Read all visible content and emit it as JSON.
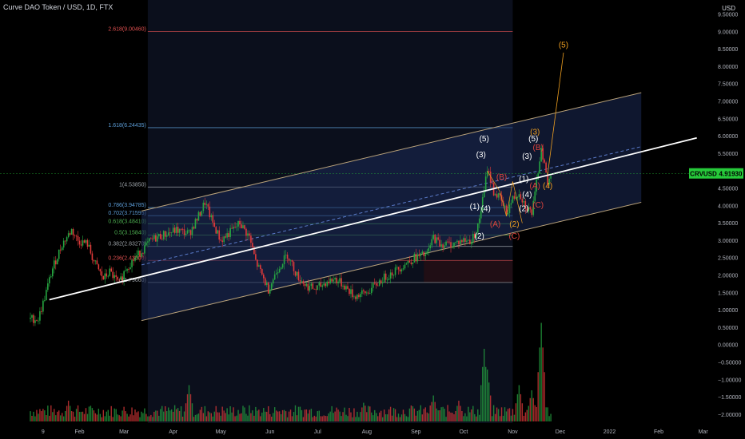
{
  "header": {
    "title": "Curve DAO Token / USD, 1D, FTX",
    "currency": "USD"
  },
  "price_badge": {
    "symbol": "CRVUSD",
    "value": "4.91930",
    "color": "#26c93a"
  },
  "colors": {
    "background": "#000000",
    "channel_fill": "#1b2a56",
    "channel_line": "#b9a27a",
    "trend_line": "#ffffff",
    "candle_up": "#26a641",
    "candle_down": "#e03a3a",
    "wave_white": "#ffffff",
    "wave_red": "#e0443c",
    "wave_orange": "#f0a020"
  },
  "chart_data": {
    "type": "candlestick",
    "title": "Curve DAO Token / USD, 1D, FTX",
    "ylabel": "USD",
    "ylim": [
      -2.2,
      9.6
    ],
    "x_ticks": [
      "9",
      "Feb",
      "Mar",
      "Apr",
      "May",
      "Jun",
      "Jul",
      "Aug",
      "Sep",
      "Oct",
      "Nov",
      "Dec",
      "2022",
      "Feb",
      "Mar"
    ],
    "x_tick_days": [
      8,
      31,
      59,
      90,
      120,
      151,
      181,
      212,
      243,
      273,
      304,
      334,
      365,
      396,
      424
    ],
    "y_ticks": [
      9.5,
      9.0,
      8.5,
      8.0,
      7.5,
      7.0,
      6.5,
      6.0,
      5.5,
      5.0,
      4.5,
      4.0,
      3.5,
      3.0,
      2.5,
      2.0,
      1.5,
      1.0,
      0.5,
      0.0,
      -0.5,
      -1.0,
      -1.5,
      -2.0
    ],
    "y_tick_labels": [
      "9.50000",
      "9.00000",
      "8.50000",
      "8.00000",
      "7.50000",
      "7.00000",
      "6.50000",
      "6.00000",
      "5.50000",
      "5.00000",
      "4.50000",
      "4.00000",
      "3.50000",
      "3.00000",
      "2.50000",
      "2.00000",
      "1.50000",
      "1.00000",
      "0.50000",
      "0.00000",
      "−0.50000",
      "−1.00000",
      "−1.50000",
      "−2.00000"
    ],
    "price_path": [
      [
        0,
        0.75
      ],
      [
        5,
        0.75
      ],
      [
        8,
        1.2
      ],
      [
        14,
        2.2
      ],
      [
        20,
        2.9
      ],
      [
        26,
        3.3
      ],
      [
        30,
        3.0
      ],
      [
        36,
        2.9
      ],
      [
        40,
        2.4
      ],
      [
        46,
        1.9
      ],
      [
        50,
        2.1
      ],
      [
        56,
        1.75
      ],
      [
        60,
        2.2
      ],
      [
        64,
        2.4
      ],
      [
        70,
        2.7
      ],
      [
        76,
        3.0
      ],
      [
        80,
        3.1
      ],
      [
        86,
        3.2
      ],
      [
        92,
        3.3
      ],
      [
        100,
        3.2
      ],
      [
        106,
        3.7
      ],
      [
        110,
        4.1
      ],
      [
        115,
        3.5
      ],
      [
        120,
        3.0
      ],
      [
        125,
        3.2
      ],
      [
        132,
        3.5
      ],
      [
        138,
        3.1
      ],
      [
        142,
        2.4
      ],
      [
        150,
        1.6
      ],
      [
        156,
        2.2
      ],
      [
        162,
        2.6
      ],
      [
        168,
        2.0
      ],
      [
        174,
        1.7
      ],
      [
        180,
        1.6
      ],
      [
        186,
        1.8
      ],
      [
        192,
        1.9
      ],
      [
        198,
        1.7
      ],
      [
        204,
        1.4
      ],
      [
        212,
        1.5
      ],
      [
        222,
        1.9
      ],
      [
        232,
        2.2
      ],
      [
        242,
        2.5
      ],
      [
        250,
        2.6
      ],
      [
        254,
        3.1
      ],
      [
        258,
        2.9
      ],
      [
        266,
        2.9
      ],
      [
        272,
        3.0
      ],
      [
        278,
        3.0
      ],
      [
        282,
        3.4
      ],
      [
        286,
        4.4
      ],
      [
        288,
        5.1
      ],
      [
        292,
        4.4
      ],
      [
        296,
        4.2
      ],
      [
        300,
        3.8
      ],
      [
        304,
        4.2
      ],
      [
        308,
        4.4
      ],
      [
        312,
        4.0
      ],
      [
        316,
        3.8
      ],
      [
        318,
        4.3
      ],
      [
        320,
        5.0
      ],
      [
        322,
        5.7
      ],
      [
        324,
        5.2
      ],
      [
        326,
        4.6
      ],
      [
        328,
        4.9
      ]
    ],
    "volume_spikes": [
      [
        286,
        0.7
      ],
      [
        322,
        0.95
      ],
      [
        288,
        0.5
      ],
      [
        308,
        0.35
      ],
      [
        316,
        0.3
      ],
      [
        254,
        0.25
      ],
      [
        100,
        0.35
      ],
      [
        24,
        0.2
      ],
      [
        210,
        0.18
      ],
      [
        270,
        0.2
      ]
    ],
    "channel": {
      "upper": [
        [
          70,
          3.85
        ],
        [
          385,
          7.25
        ]
      ],
      "lower": [
        [
          70,
          0.7
        ],
        [
          385,
          4.1
        ]
      ],
      "mid": [
        [
          70,
          2.3
        ],
        [
          385,
          5.7
        ]
      ]
    },
    "trend_line": [
      [
        12,
        1.3
      ],
      [
        420,
        5.95
      ]
    ],
    "fib_levels": [
      {
        "label": "2.618(9.00460)",
        "value": 9.0046,
        "color": "#e05050"
      },
      {
        "label": "1.618(6.24435)",
        "value": 6.24435,
        "color": "#5b9bd5"
      },
      {
        "label": "1(4.53850)",
        "value": 4.5385,
        "color": "#9aa0a6"
      },
      {
        "label": "0.786(3.94785)",
        "value": 3.94785,
        "color": "#5b9bd5"
      },
      {
        "label": "0.702(3.71595)",
        "value": 3.71595,
        "color": "#5b9bd5"
      },
      {
        "label": "0.618(3.48410)",
        "value": 3.4841,
        "color": "#4caf50"
      },
      {
        "label": "0.5(3.15840)",
        "value": 3.1584,
        "color": "#4caf50"
      },
      {
        "label": "0.382(2.83270)",
        "value": 2.8327,
        "color": "#9aa0a6"
      },
      {
        "label": "0.236(2.43000)",
        "value": 2.43,
        "color": "#e05050"
      },
      {
        "label": "0(1.79660)",
        "value": 1.7966,
        "color": "#9aa0a6"
      }
    ],
    "wave_labels": [
      {
        "text": "(5)",
        "day": 336,
        "value": 8.55,
        "color": "#f0a020"
      },
      {
        "text": "(5)",
        "day": 286,
        "value": 5.85,
        "color": "#ffffff"
      },
      {
        "text": "(3)",
        "day": 284,
        "value": 5.4,
        "color": "#ffffff"
      },
      {
        "text": "(1)",
        "day": 280,
        "value": 3.9,
        "color": "#ffffff"
      },
      {
        "text": "(4)",
        "day": 287,
        "value": 3.85,
        "color": "#ffffff"
      },
      {
        "text": "(2)",
        "day": 283,
        "value": 3.05,
        "color": "#ffffff"
      },
      {
        "text": "(B)",
        "day": 297,
        "value": 4.75,
        "color": "#e0443c"
      },
      {
        "text": "(A)",
        "day": 293,
        "value": 3.4,
        "color": "#e0443c"
      },
      {
        "text": "(2)",
        "day": 305,
        "value": 3.4,
        "color": "#f0a020"
      },
      {
        "text": "(C)",
        "day": 305,
        "value": 3.05,
        "color": "#e0443c"
      },
      {
        "text": "(3)",
        "day": 313,
        "value": 5.35,
        "color": "#ffffff"
      },
      {
        "text": "(1)",
        "day": 311,
        "value": 4.7,
        "color": "#ffffff"
      },
      {
        "text": "(4)",
        "day": 313,
        "value": 4.25,
        "color": "#ffffff"
      },
      {
        "text": "(2)",
        "day": 311,
        "value": 3.85,
        "color": "#ffffff"
      },
      {
        "text": "(3)",
        "day": 318,
        "value": 6.05,
        "color": "#f0a020"
      },
      {
        "text": "(5)",
        "day": 317,
        "value": 5.85,
        "color": "#ffffff"
      },
      {
        "text": "(B)",
        "day": 320,
        "value": 5.6,
        "color": "#e0443c"
      },
      {
        "text": "(A)",
        "day": 318,
        "value": 4.5,
        "color": "#e0443c"
      },
      {
        "text": "(4)",
        "day": 326,
        "value": 4.5,
        "color": "#f0a020"
      },
      {
        "text": "(C)",
        "day": 320,
        "value": 3.95,
        "color": "#e0443c"
      }
    ]
  }
}
